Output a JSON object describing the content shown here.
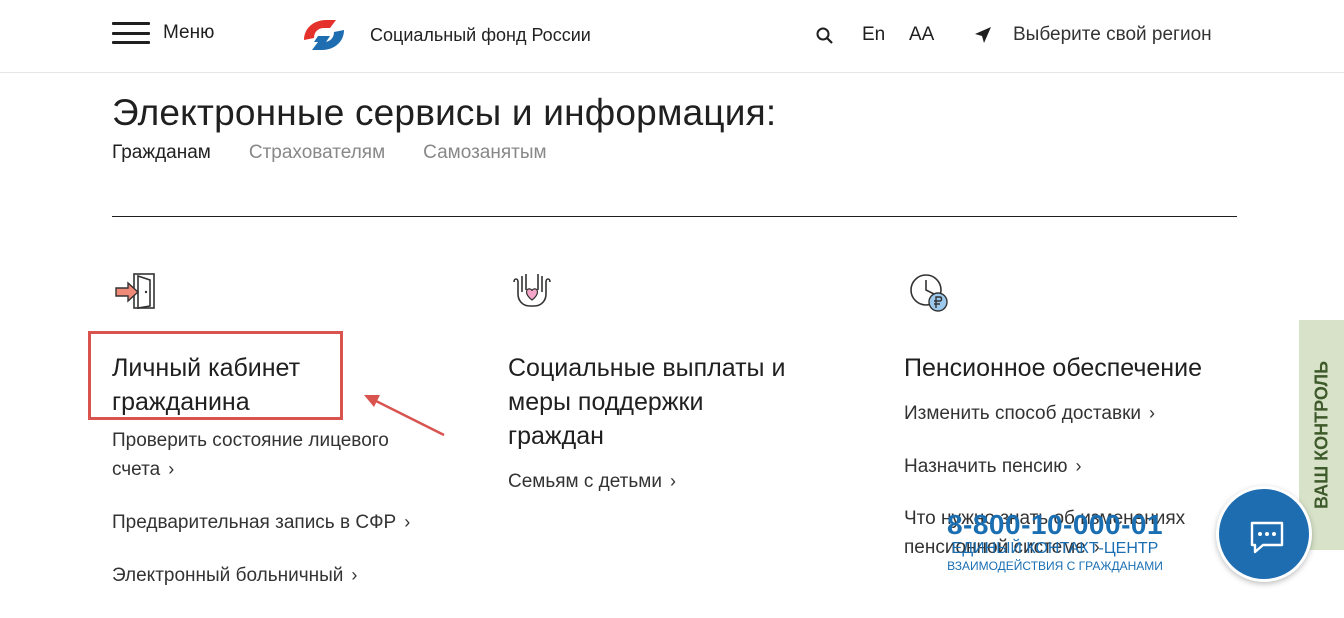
{
  "header": {
    "menu_label": "Меню",
    "brand_name": "Социальный фонд России",
    "lang_label": "En",
    "font_size_label": "AA",
    "region_label": "Выберите свой регион"
  },
  "page": {
    "title": "Электронные сервисы и информация:",
    "tabs": [
      {
        "label": "Гражданам",
        "active": true
      },
      {
        "label": "Страхователям",
        "active": false
      },
      {
        "label": "Самозанятым",
        "active": false
      }
    ]
  },
  "columns": [
    {
      "icon": "door-enter-icon",
      "title_line1": "Личный кабинет",
      "title_line2": "гражданина",
      "links": [
        {
          "line1": "Проверить состояние лицевого",
          "line2": "счета"
        },
        {
          "line1": "Предварительная запись в СФР"
        },
        {
          "line1": "Электронный больничный"
        }
      ]
    },
    {
      "icon": "hands-heart-icon",
      "title_line1": "Социальные выплаты и",
      "title_line2": "меры поддержки",
      "title_line3": "граждан",
      "links": [
        {
          "line1": "Семьям с детьми"
        }
      ]
    },
    {
      "icon": "clock-ruble-icon",
      "title_line1": "Пенсионное обеспечение",
      "links": [
        {
          "line1": "Изменить способ доставки"
        },
        {
          "line1": "Назначить пенсию"
        },
        {
          "line1": "Что нужно знать об изменениях",
          "line2": "пенсионной системе"
        }
      ]
    }
  ],
  "side_tab_label": "ВАШ КОНТРОЛЬ",
  "contact": {
    "phone": "8-800-10-000-01",
    "line1": "ЕДИНЫЙ КОНТАКТ-ЦЕНТР",
    "line2": "ВЗАИМОДЕЙСТВИЯ С ГРАЖДАНАМИ"
  },
  "chevron": "›",
  "colors": {
    "annotation": "#d9534f",
    "brand_blue": "#1e6db0",
    "brand_red": "#e4312b",
    "side_tab": "#d7e2c8"
  }
}
